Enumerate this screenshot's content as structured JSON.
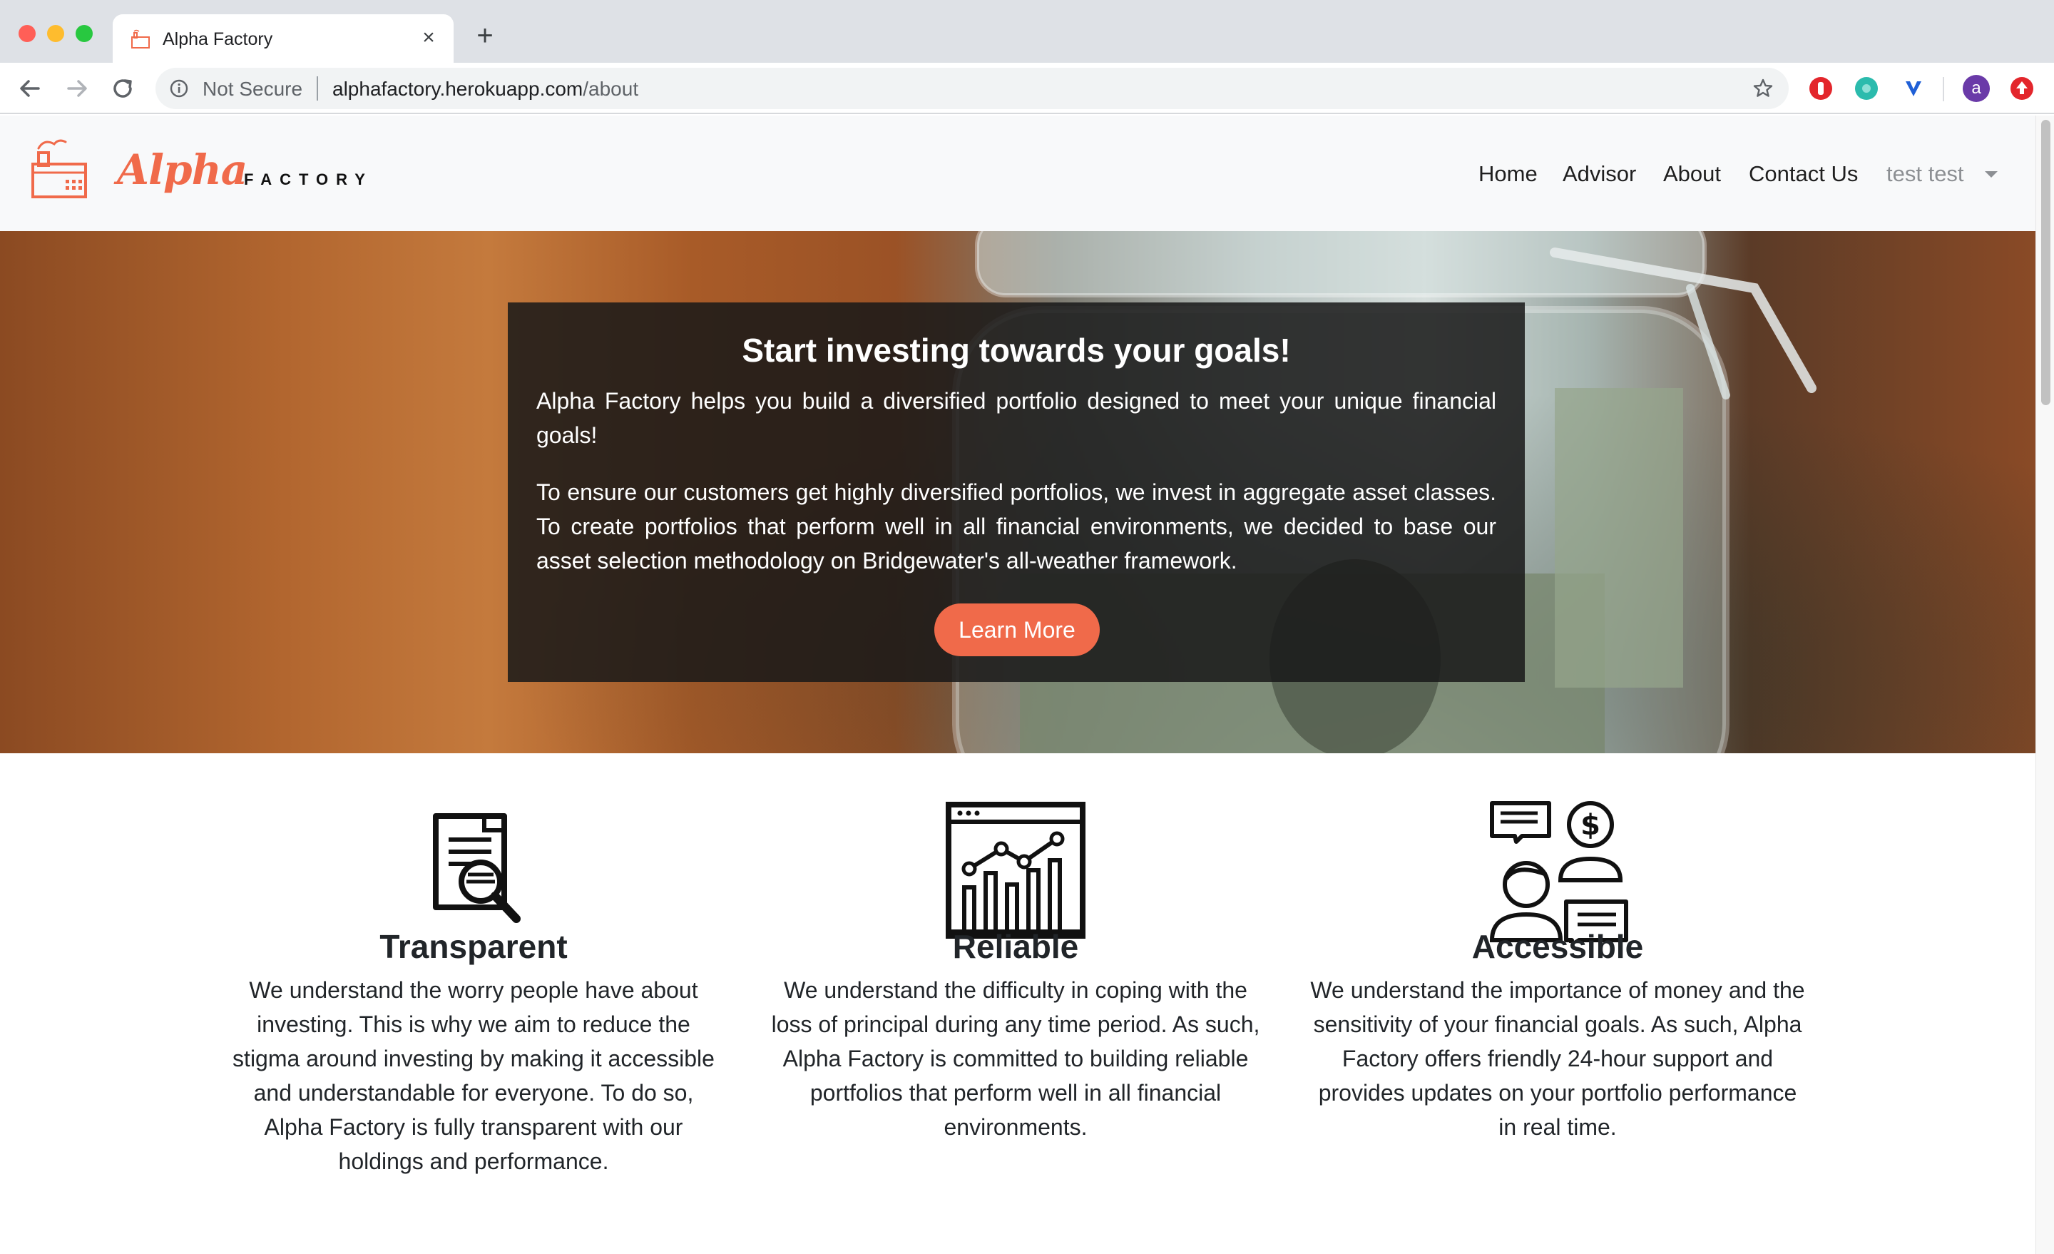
{
  "browser": {
    "tab_title": "Alpha Factory",
    "tab_close": "×",
    "new_tab": "+",
    "security_label": "Not Secure",
    "url_host": "alphafactory.herokuapp.com",
    "url_path": "/about",
    "avatar_letter": "a"
  },
  "navbar": {
    "brand_alpha": "Alpha",
    "brand_factory": "FACTORY",
    "links": [
      "Home",
      "Advisor",
      "About",
      "Contact Us"
    ],
    "user": "test test"
  },
  "hero": {
    "title": "Start investing towards your goals!",
    "paragraph1": "Alpha Factory helps you build a diversified portfolio designed to meet your unique financial goals!",
    "paragraph2": "To ensure our customers get highly diversified portfolios, we invest in aggregate asset classes. To create portfolios that perform well in all financial environments, we decided to base our asset selection methodology on Bridgewater's all-weather framework.",
    "cta": "Learn More"
  },
  "features": [
    {
      "icon": "document-search-icon",
      "title": "Transparent",
      "text": "We understand the worry people have about investing. This is why we aim to reduce the stigma around investing by making it accessible and understandable for everyone. To do so, Alpha Factory is fully transparent with our holdings and performance."
    },
    {
      "icon": "growth-chart-icon",
      "title": "Reliable",
      "text": "We understand the difficulty in coping with the loss of principal during any time period. As such, Alpha Factory is committed to building reliable portfolios that perform well in all financial environments."
    },
    {
      "icon": "customer-support-icon",
      "title": "Accessible",
      "text": "We understand the importance of money and the sensitivity of your financial goals. As such, Alpha Factory offers friendly 24-hour support and provides updates on your portfolio performance in real time."
    }
  ],
  "colors": {
    "accent": "#f06a4a",
    "navbar_bg": "#f8f9fa",
    "hero_card": "#181818"
  }
}
